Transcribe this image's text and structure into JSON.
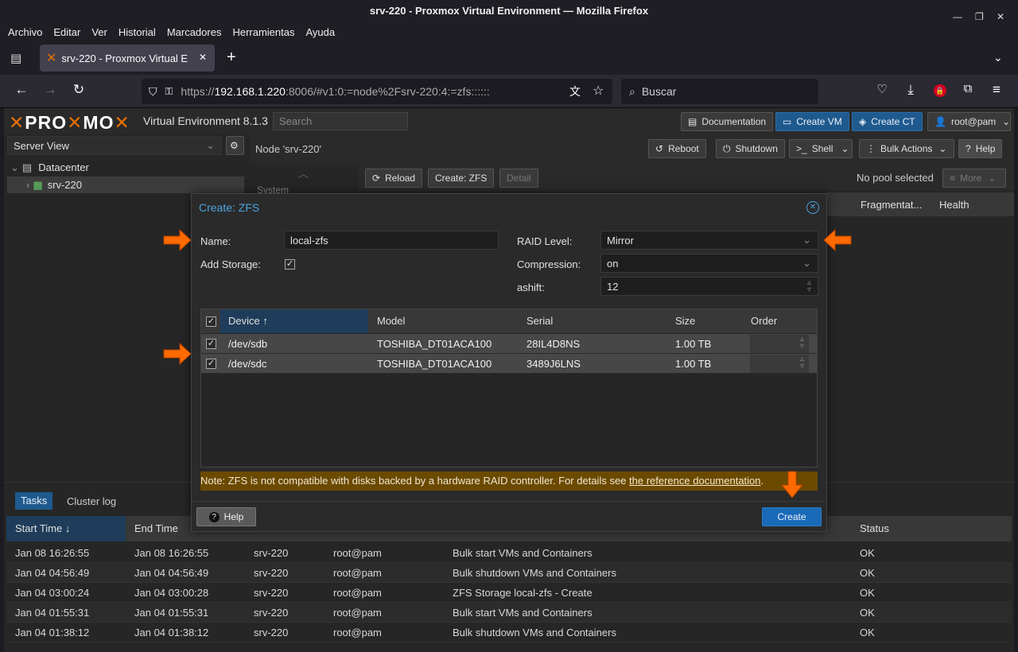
{
  "window": {
    "title": "srv-220 - Proxmox Virtual Environment — Mozilla Firefox"
  },
  "menu": [
    "Archivo",
    "Editar",
    "Ver",
    "Historial",
    "Marcadores",
    "Herramientas",
    "Ayuda"
  ],
  "tab": {
    "title": "srv-220 - Proxmox Virtual E"
  },
  "url": {
    "prefix": "https://",
    "host": "192.168.1.220",
    "rest": ":8006/#v1:0:=node%2Fsrv-220:4:=zfs::::::"
  },
  "search": {
    "placeholder": "Buscar"
  },
  "pve": {
    "version": "Virtual Environment 8.1.3",
    "search_placeholder": "Search",
    "documentation": "Documentation",
    "create_vm": "Create VM",
    "create_ct": "Create CT",
    "user": "root@pam",
    "server_view": "Server View",
    "tree": {
      "datacenter": "Datacenter",
      "node": "srv-220"
    },
    "node_title": "Node 'srv-220'",
    "reboot": "Reboot",
    "shutdown": "Shutdown",
    "shell": "Shell",
    "bulk_actions": "Bulk Actions",
    "help": "Help",
    "reload": "Reload",
    "create_zfs": "Create: ZFS",
    "detail": "Detail",
    "no_pool": "No pool selected",
    "more": "More",
    "system_partial": "System",
    "col_fragment": "Fragmentat...",
    "col_health": "Health"
  },
  "dialog": {
    "title": "Create: ZFS",
    "name_label": "Name:",
    "name_value": "local-zfs",
    "add_storage_label": "Add Storage:",
    "raid_label": "RAID Level:",
    "raid_value": "Mirror",
    "compression_label": "Compression:",
    "compression_value": "on",
    "ashift_label": "ashift:",
    "ashift_value": "12",
    "columns": [
      "Device",
      "Model",
      "Serial",
      "Size",
      "Order"
    ],
    "rows": [
      {
        "device": "/dev/sdb",
        "model": "TOSHIBA_DT01ACA100",
        "serial": "28IL4D8NS",
        "size": "1.00 TB"
      },
      {
        "device": "/dev/sdc",
        "model": "TOSHIBA_DT01ACA100",
        "serial": "3489J6LNS",
        "size": "1.00 TB"
      }
    ],
    "note_text": "Note: ZFS is not compatible with disks backed by a hardware RAID controller. For details see ",
    "note_link": "the reference documentation",
    "note_end": ".",
    "help": "Help",
    "create": "Create"
  },
  "tasks": {
    "tab_tasks": "Tasks",
    "tab_cluster": "Cluster log",
    "columns": [
      "Start Time",
      "End Time",
      "",
      "",
      "",
      "Status"
    ],
    "rows": [
      {
        "start": "Jan 08 16:26:55",
        "end": "Jan 08 16:26:55",
        "node": "srv-220",
        "user": "root@pam",
        "desc": "Bulk start VMs and Containers",
        "status": "OK"
      },
      {
        "start": "Jan 04 04:56:49",
        "end": "Jan 04 04:56:49",
        "node": "srv-220",
        "user": "root@pam",
        "desc": "Bulk shutdown VMs and Containers",
        "status": "OK"
      },
      {
        "start": "Jan 04 03:00:24",
        "end": "Jan 04 03:00:28",
        "node": "srv-220",
        "user": "root@pam",
        "desc": "ZFS Storage local-zfs - Create",
        "status": "OK"
      },
      {
        "start": "Jan 04 01:55:31",
        "end": "Jan 04 01:55:31",
        "node": "srv-220",
        "user": "root@pam",
        "desc": "Bulk start VMs and Containers",
        "status": "OK"
      },
      {
        "start": "Jan 04 01:38:12",
        "end": "Jan 04 01:38:12",
        "node": "srv-220",
        "user": "root@pam",
        "desc": "Bulk shutdown VMs and Containers",
        "status": "OK"
      }
    ]
  },
  "colors": {
    "accent": "#e57000",
    "blue": "#1f5a8e",
    "note_bg": "#6b4a00"
  }
}
